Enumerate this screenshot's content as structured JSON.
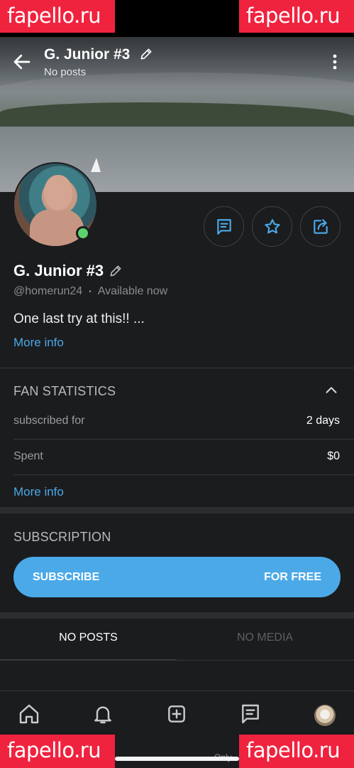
{
  "watermark": {
    "text": "fapello.ru",
    "color": "#f0233f"
  },
  "header": {
    "title": "G. Junior #3",
    "subtitle": "No posts"
  },
  "profile": {
    "name": "G. Junior #3",
    "handle": "@homerun24",
    "status_separator": "•",
    "availability": "Available now",
    "bio": "One last try at this!! ...",
    "more_info": "More info",
    "online": true
  },
  "actions": {
    "message_icon": "message-icon",
    "favorite_icon": "star-icon",
    "share_icon": "share-icon"
  },
  "fan_statistics": {
    "title": "FAN STATISTICS",
    "rows": [
      {
        "label": "subscribed for",
        "value": "2 days"
      },
      {
        "label": "Spent",
        "value": "$0"
      }
    ],
    "more_info": "More info"
  },
  "subscription": {
    "title": "SUBSCRIPTION",
    "button_label": "SUBSCRIBE",
    "button_price": "FOR FREE"
  },
  "tabs": [
    {
      "label": "NO POSTS",
      "active": true
    },
    {
      "label": "NO MEDIA",
      "active": false
    }
  ],
  "bottom_nav": [
    "home-icon",
    "bell-icon",
    "add-icon",
    "messages-icon",
    "profile-avatar"
  ],
  "home_caption": "Only",
  "colors": {
    "accent": "#4ba9e8",
    "online": "#5dd26c",
    "background": "#1b1c1e"
  }
}
